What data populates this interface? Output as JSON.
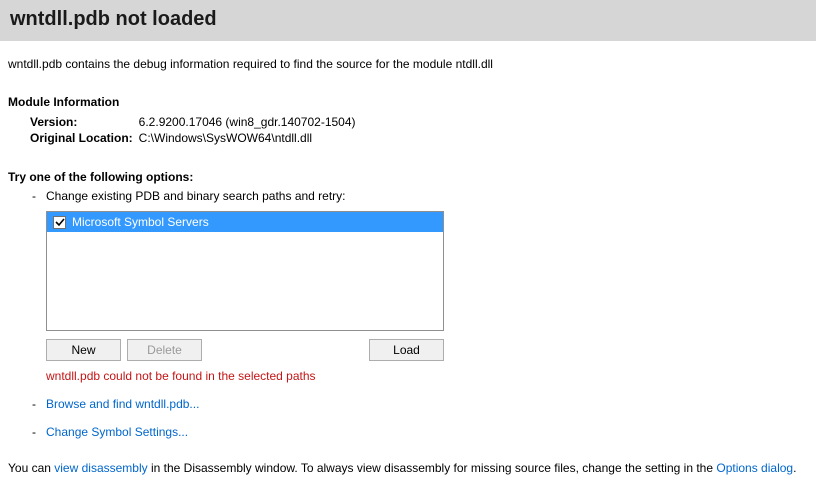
{
  "header": {
    "title": "wntdll.pdb not loaded"
  },
  "intro": "wntdll.pdb contains the debug information required to find the source for the module ntdll.dll",
  "module_info": {
    "heading": "Module Information",
    "version_label": "Version:",
    "version_value": "6.2.9200.17046 (win8_gdr.140702-1504)",
    "location_label": "Original Location:",
    "location_value": "C:\\Windows\\SysWOW64\\ntdll.dll"
  },
  "options": {
    "heading": "Try one of the following options:",
    "change_paths_label": "Change existing PDB and binary search paths and retry:",
    "symbol_servers": [
      {
        "label": "Microsoft Symbol Servers",
        "checked": true
      }
    ],
    "buttons": {
      "new": "New",
      "delete": "Delete",
      "load": "Load"
    },
    "error": "wntdll.pdb could not be found in the selected paths",
    "browse_link": "Browse and find wntdll.pdb...",
    "settings_link": "Change Symbol Settings..."
  },
  "footer": {
    "prefix": "You can ",
    "link1": "view disassembly",
    "middle": " in the Disassembly window. To always view disassembly for missing source files, change the setting in the ",
    "link2": "Options dialog",
    "suffix": "."
  }
}
